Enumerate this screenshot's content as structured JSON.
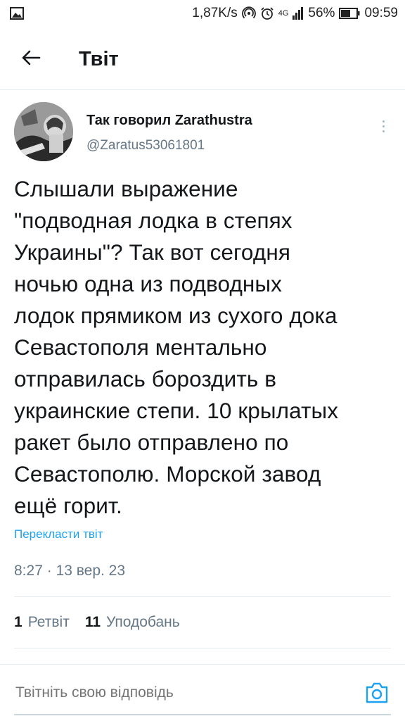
{
  "status_bar": {
    "speed": "1,87K/s",
    "network_type": "4G",
    "battery": "56%",
    "time": "09:59",
    "icons": [
      "image-icon",
      "hotspot-icon",
      "alarm-icon",
      "signal-icon",
      "battery-icon"
    ]
  },
  "header": {
    "back_icon": "arrow-left-icon",
    "title": "Твіт"
  },
  "tweet": {
    "author": {
      "display_name": "Так говорил Zarathustra",
      "handle": "@Zaratus53061801"
    },
    "text": "Слышали выражение\n\"подводная лодка в степях\nУкраины\"? Так вот сегодня\nночью одна из подводных\nлодок прямиком из сухого дока\nСевастополя ментально\nотправилась бороздить в\nукраинские степи.  10 крылатых\nракет было отправлено по\nСевастополю. Морской завод\nещё горит.",
    "translate_label": "Перекласти твіт",
    "timestamp": "8:27 · 13 вер. 23",
    "stats": {
      "retweets_count": "1",
      "retweets_label": "Ретвіт",
      "likes_count": "11",
      "likes_label": "Уподобань"
    }
  },
  "reply": {
    "placeholder": "Твітніть свою відповідь",
    "camera_icon": "camera-icon"
  },
  "colors": {
    "accent": "#1da1f2",
    "text": "#14171a",
    "secondary": "#657786",
    "divider": "#e6ecf0"
  }
}
